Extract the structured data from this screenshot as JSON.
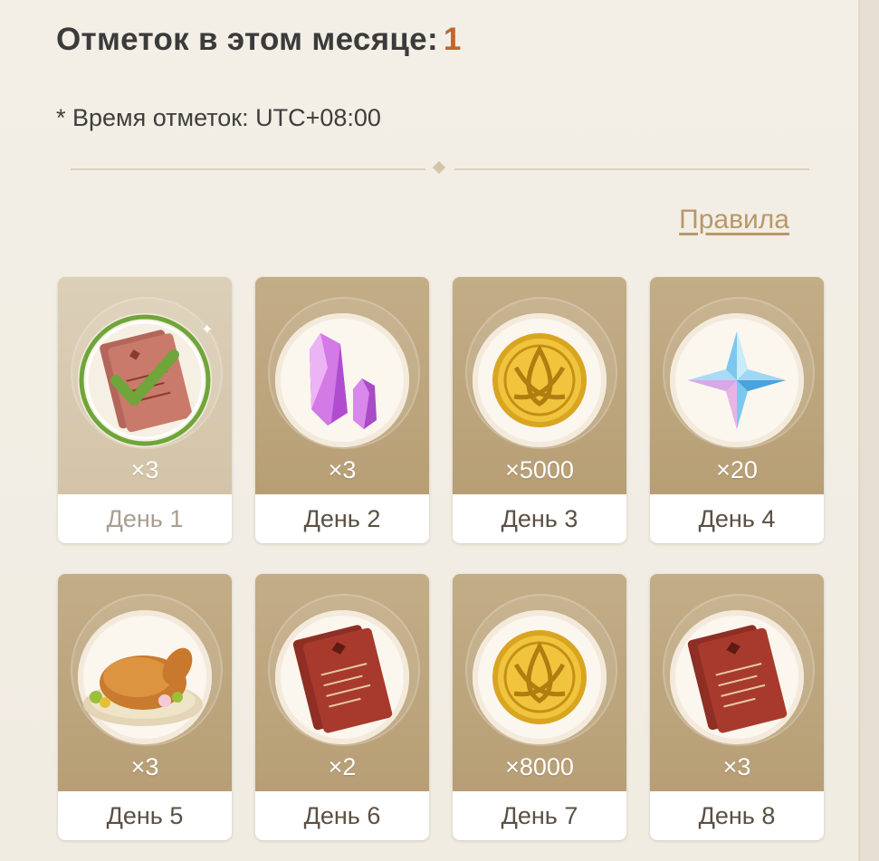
{
  "header": {
    "title": "Отметок в этом месяце:",
    "count": "1",
    "timezone_note": "* Время отметок: UTC+08:00",
    "rules_link": "Правила"
  },
  "rewards": [
    {
      "qty": "×3",
      "day": "День 1",
      "item_icon": "companionship-exp-icon",
      "claimed": true
    },
    {
      "qty": "×3",
      "day": "День 2",
      "item_icon": "crystal-ore-icon",
      "claimed": false
    },
    {
      "qty": "×5000",
      "day": "День 3",
      "item_icon": "mora-coin-icon",
      "claimed": false
    },
    {
      "qty": "×20",
      "day": "День 4",
      "item_icon": "primogem-icon",
      "claimed": false
    },
    {
      "qty": "×3",
      "day": "День 5",
      "item_icon": "roast-chicken-icon",
      "claimed": false
    },
    {
      "qty": "×2",
      "day": "День 6",
      "item_icon": "experience-book-icon",
      "claimed": false
    },
    {
      "qty": "×8000",
      "day": "День 7",
      "item_icon": "mora-coin-icon",
      "claimed": false
    },
    {
      "qty": "×3",
      "day": "День 8",
      "item_icon": "experience-book-icon",
      "claimed": false
    }
  ],
  "colors": {
    "accent_count": "#c0662f",
    "rules_link": "#b99867",
    "card_top": "#b79e75",
    "check_green": "#6fa53a"
  }
}
